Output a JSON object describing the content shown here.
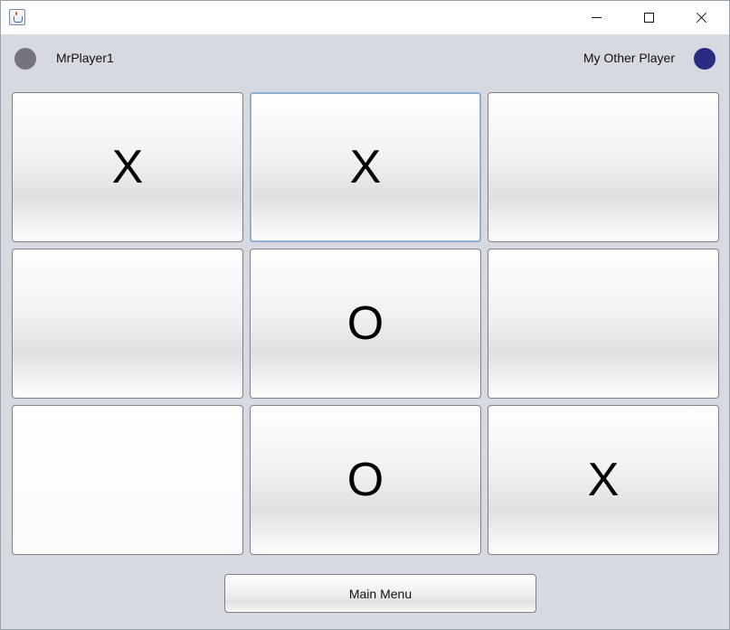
{
  "window": {
    "title": "",
    "minimize_icon": "minimize-icon",
    "maximize_icon": "maximize-icon",
    "close_icon": "close-icon"
  },
  "players": {
    "player1": {
      "name": "MrPlayer1",
      "indicator_color": "#74747c"
    },
    "player2": {
      "name": "My Other Player",
      "indicator_color": "#2a2c84"
    }
  },
  "board": {
    "cells": [
      "X",
      "X",
      "",
      "",
      "O",
      "",
      "",
      "O",
      "X"
    ]
  },
  "main_menu_label": "Main Menu"
}
